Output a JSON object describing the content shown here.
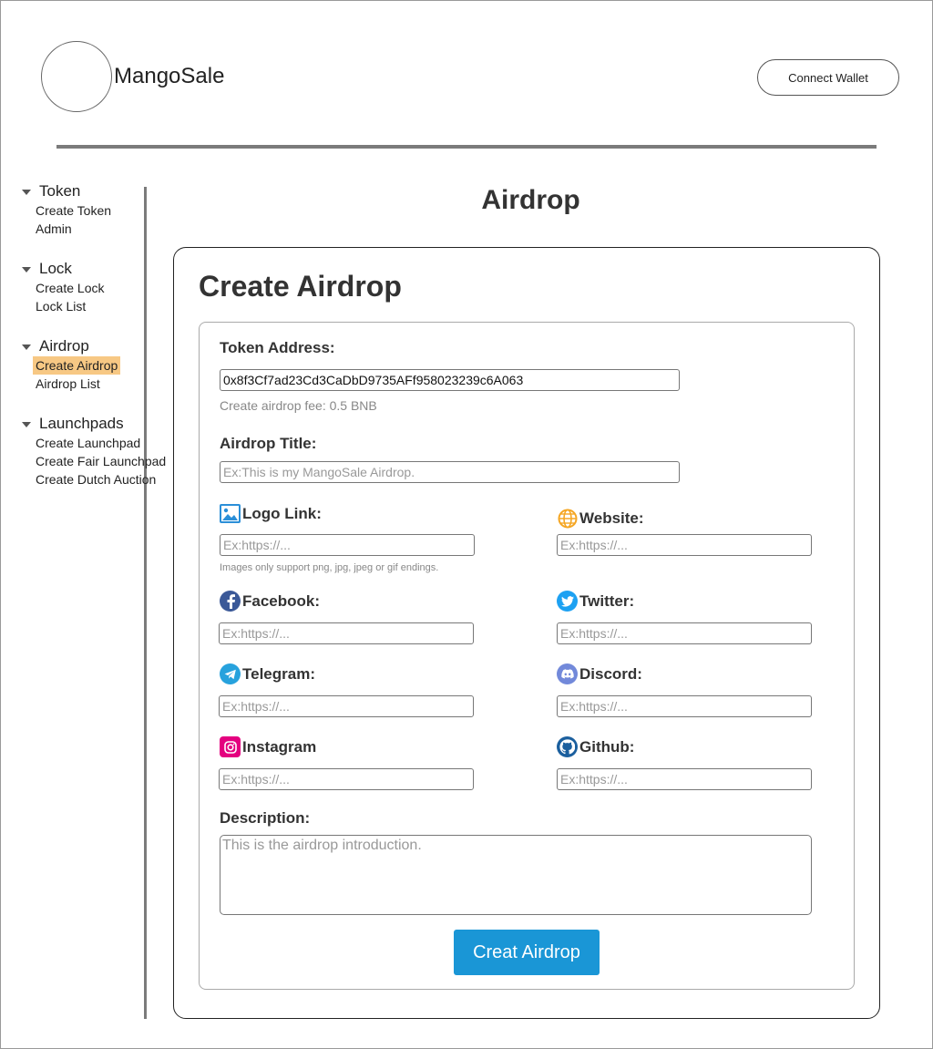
{
  "header": {
    "brand": "MangoSale",
    "connect_wallet": "Connect Wallet"
  },
  "sidebar": {
    "groups": [
      {
        "label": "Token",
        "items": [
          "Create Token",
          "Admin"
        ]
      },
      {
        "label": "Lock",
        "items": [
          "Create Lock",
          "Lock List"
        ]
      },
      {
        "label": "Airdrop",
        "items": [
          "Create Airdrop",
          "Airdrop List"
        ],
        "active": "Create Airdrop"
      },
      {
        "label": "Launchpads",
        "items": [
          "Create Launchpad",
          "Create Fair Launchpad",
          "Create Dutch Auction"
        ]
      }
    ]
  },
  "page": {
    "title": "Airdrop"
  },
  "form": {
    "title": "Create Airdrop",
    "token_address": {
      "label": "Token Address:",
      "value": "0x8f3Cf7ad23Cd3CaDbD9735AFf958023239c6A063",
      "hint": "Create airdrop fee: 0.5 BNB"
    },
    "airdrop_title": {
      "label": "Airdrop Title:",
      "placeholder": "Ex:This is my MangoSale Airdrop."
    },
    "logo_link": {
      "label": "Logo Link:",
      "placeholder": "Ex:https://...",
      "hint": "Images only support png, jpg, jpeg or gif endings."
    },
    "website": {
      "label": "Website:",
      "placeholder": "Ex:https://..."
    },
    "facebook": {
      "label": "Facebook:",
      "placeholder": "Ex:https://..."
    },
    "twitter": {
      "label": "Twitter:",
      "placeholder": "Ex:https://..."
    },
    "telegram": {
      "label": "Telegram:",
      "placeholder": "Ex:https://..."
    },
    "discord": {
      "label": "Discord:",
      "placeholder": "Ex:https://..."
    },
    "instagram": {
      "label": "Instagram",
      "placeholder": "Ex:https://..."
    },
    "github": {
      "label": "Github:",
      "placeholder": "Ex:https://..."
    },
    "description": {
      "label": "Description:",
      "placeholder": "This is the airdrop introduction."
    },
    "submit": "Creat Airdrop"
  },
  "colors": {
    "primary": "#1a96d6",
    "active_nav": "#f7c884",
    "facebook": "#3b5998",
    "twitter": "#1da1f2",
    "telegram": "#27a2dd",
    "discord": "#7289da",
    "instagram": "#e4007f",
    "github": "#1b5f9e",
    "website": "#f5a623"
  }
}
